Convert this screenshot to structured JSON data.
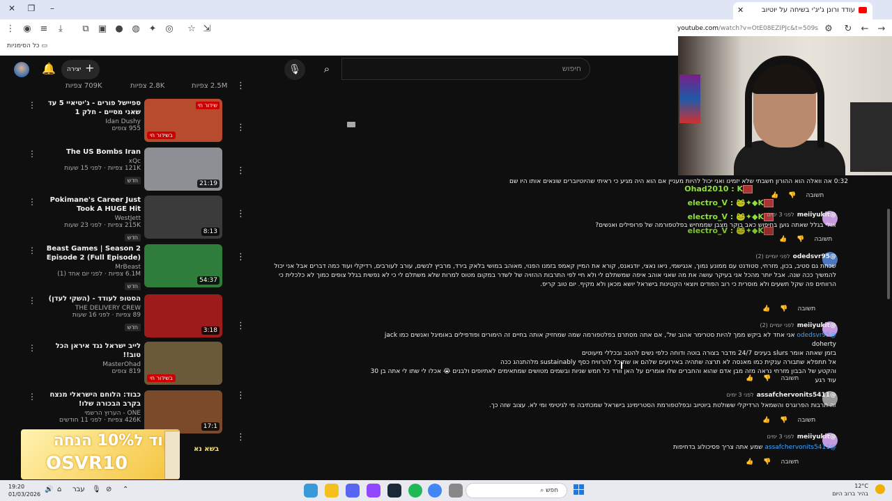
{
  "browser": {
    "tab_title": "עודד ורונן ג'יג'י בשיחה על יוטיוב",
    "url_host": "youtube.com",
    "url_rest": "/watch?v=OtE08EZIPJc&t=509s",
    "bookmarks_all": "כל הסימניות"
  },
  "header": {
    "create_label": "יצירה",
    "search_placeholder": "חיפוש"
  },
  "top_views": [
    "2.5M צפיות",
    "2.8K צפיות",
    "709K צפיות"
  ],
  "recommendations": [
    {
      "title": "ספיישל פורים - ג'יטיאיי 5 עד שאני מסיים - חלק 1",
      "channel": "Idan Dushy",
      "views": "955 צופים",
      "badge": "בשידור חי",
      "top_badge": "שידור חי",
      "duration": "",
      "new": "",
      "thumb_bg": "#b84b2e"
    },
    {
      "title": "The US Bombs Iran",
      "channel": "xQc",
      "views": "121K צפיות · לפני 15 שעות",
      "badge": "",
      "top_badge": "",
      "duration": "21:19",
      "new": "חדש",
      "thumb_bg": "#8c8f94"
    },
    {
      "title": "Pokimane's Career Just Took A HUGE Hit",
      "channel": "WestJett",
      "views": "215K צפיות · לפני 23 שעות",
      "badge": "",
      "top_badge": "",
      "duration": "8:13",
      "new": "חדש",
      "thumb_bg": "#3b3b3b"
    },
    {
      "title": "Beast Games | Season 2 Episode 2 (Full Episode)",
      "channel": "MrBeast",
      "views": "6.1M צפיות · לפני יום אחד (1)",
      "badge": "",
      "top_badge": "",
      "duration": "54:37",
      "new": "חדש",
      "thumb_bg": "#2e7d3a"
    },
    {
      "title": "הסטופ לעודד - (השקי לעדן)",
      "channel": "THE DELIVERY CREW",
      "views": "89 צפיות · לפני 16 שעות",
      "badge": "",
      "top_badge": "",
      "duration": "3:18",
      "new": "חדש",
      "thumb_bg": "#9e1b1b"
    },
    {
      "title": "לייב ישראל נגד איראן הכל טוב!!",
      "channel": "MasterOhad",
      "views": "819 צופים",
      "badge": "בשידור חי",
      "top_badge": "",
      "duration": "",
      "new": "",
      "thumb_bg": "#6b5a3a"
    },
    {
      "title": "כבוד: הלוחם הישראלי מנצח בקרב הבכורה שלו!",
      "channel": "ONE - הערוץ הרשמי",
      "views": "426K צפיות · לפני 11 חודשים",
      "badge": "",
      "top_badge": "",
      "duration": "17:1",
      "new": "",
      "thumb_bg": "#7a4a2a"
    }
  ],
  "promo": {
    "line1": "קוד ל10% הנחה",
    "line2": "OSVR10",
    "thumb_caption": "בשא נא"
  },
  "overlay": {
    "line0": "0:32 אה וואלה הוא ההורון חשבתי שלא יזמינו ואני יכול להיות מעניין אם הוא היה מגיע כי ראיתי שהיוטיוברים שונאים אותו היו שם",
    "user1": "Ohad2010 :",
    "user2": "electro_V :",
    "user3": "electro_V :"
  },
  "comments": [
    {
      "user": "@meiiyukit",
      "ago": "לפני 3 ימים",
      "text": "אולי בגלל שאתה גוען בחיפוש כאב בוקר מצבן שממחיש בפלטפורמה של פרופילים ואנשים?",
      "reply_label": "תשובה"
    },
    {
      "user": "@odedsvr95",
      "ago": "לפני יומיים (2)",
      "text": "שכחת גם סטיב, בכון, מזרחי, סטודנט עם ממונע נמוך, אנגישמי, ניאו נאצי, יודגאנס, קורא את המיין קאמפ בזמנו הפנוי, מאוהב במושי בלאק בירד, מרביץ לנשים, עורב לעורבים, רדיקלי ועוד כמה דברים אבל אני יכול להמשיך ככה שנה. אבל יותר מהכל אני בעיקר עושה את מה שאני אוהב איפה שמשתלם לי ולא חיי לפי התרבות ההזויה של לשדר במקום מטוס למרות שלא משתלם לי כי לא נפשית בגלל צופים כמוך לא כלכלית כי הרווחים פה שקל תשעים ולא מוסרית כי רוב הפודים ויוצאי הקטינות בישראל יושא מכאן ולא מקיף. יום טוב קריפ.",
      "reply_label": "תשובה"
    },
    {
      "user": "@meiiyukit",
      "ago": "לפני יומיים (2)",
      "mention": "@odedsvr95",
      "text_lines": [
        "אני אחד לא ביקש ממך להיות סטרימר אהוב של', אם אתה מסתרם בפלטפורמה שמה שמחזיק אותה בחיים זה הימורים ופודפילים באומיגל ואנשים כמו jack doherty",
        "בזמן שאתה אומר slurs בעינים 24/7 מדבר בצורה בוטה ודוחה כלפי נשים להטב ובכללי מיעוטים",
        "אל תתפלא שתבורה ענקית כמו מאנסה לא תרצה שתהיה באירועים שלהם או שתוכל להרוויח כסף sustainably מלהתנהג ככה",
        "והקטע של הבבון מזרחי נראה מזה מבן אדם שהוא והחברים שלו אומרים על האן וורד כל חמש שניות ובשמים מטושים שמתאימים לאתיופים ולבנים 😭 אכלו לי שתו לי אתה בן 30 עוד רגע"
      ],
      "reply_label": "תשובה"
    },
    {
      "user": "@assafchervonits5411",
      "ago": "לפני 3 ימים",
      "text": "זה תרבות הפרוגרס והשמאל הרדיקלי ששולטת ביוטיוב ובפלטפורמת הסטרימינג בישראל שמכתיבה מי לגיטימי ומי לא.  עצוב שזה כך.",
      "reply_label": "תשובה"
    },
    {
      "user": "@meiiyukit",
      "ago": "לפני 3 ימים",
      "mention": "@assafchervonits5411",
      "text": "שמע אתה צריך פסיכולוג בדחיפות",
      "reply_label": "תשובה"
    }
  ],
  "taskbar": {
    "time": "19:20",
    "date": "01/03/2026",
    "lang": "עבר",
    "search": "חפש",
    "temp": "12°C",
    "weather": "בהיר ברוב היום"
  }
}
